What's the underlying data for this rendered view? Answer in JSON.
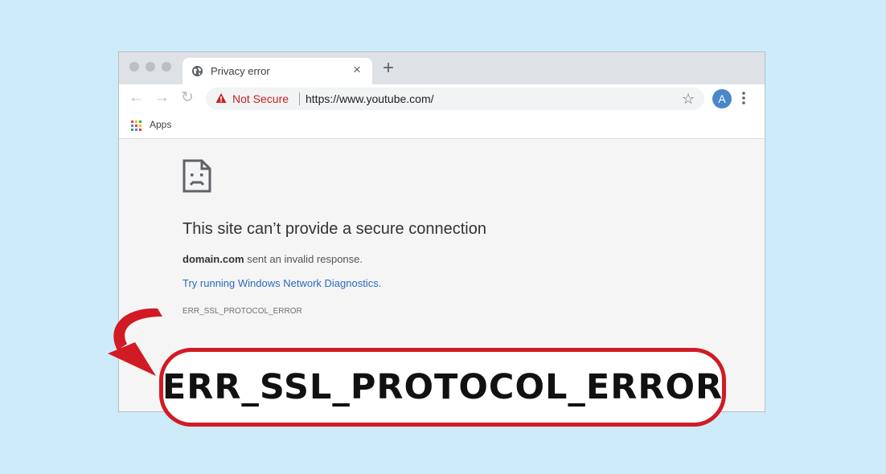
{
  "browser": {
    "tab": {
      "title": "Privacy error",
      "close_glyph": "×"
    },
    "new_tab_glyph": "+",
    "toolbar": {
      "back_glyph": "←",
      "forward_glyph": "→",
      "reload_glyph": "↻",
      "security_label": "Not Secure",
      "url": "https://www.youtube.com/",
      "star_glyph": "☆",
      "avatar_letter": "A"
    },
    "bookmarks": {
      "apps_label": "Apps"
    }
  },
  "error_page": {
    "heading": "This site can’t provide a secure connection",
    "detail_domain": "domain.com",
    "detail_rest": " sent an invalid response.",
    "diagnostics_link": "Try running Windows Network Diagnostics.",
    "error_code": "ERR_SSL_PROTOCOL_ERROR"
  },
  "callout": {
    "text": "ERR_SSL_PROTOCOL_ERROR"
  },
  "colors": {
    "page_background": "#cdebf9",
    "not_secure_red": "#c5221f",
    "link_blue": "#2a6ac1",
    "callout_red": "#d11b24"
  },
  "icons": [
    "globe-icon",
    "warning-icon",
    "star-icon",
    "avatar",
    "more-menu-icon",
    "apps-grid-icon",
    "sad-page-icon",
    "curved-arrow-icon"
  ]
}
